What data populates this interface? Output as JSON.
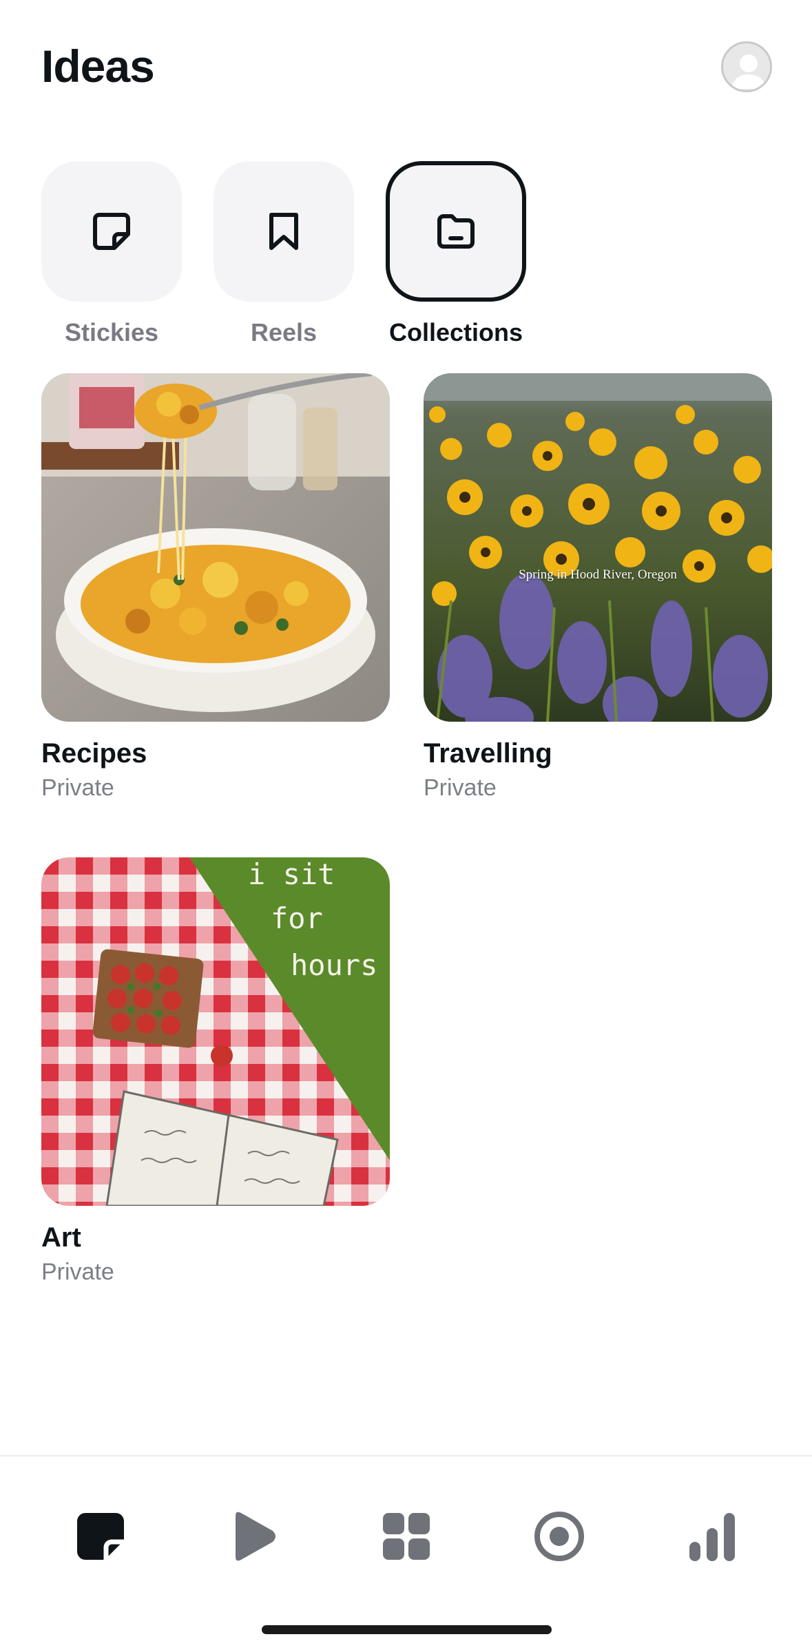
{
  "header": {
    "title": "Ideas"
  },
  "segments": [
    {
      "label": "Stickies",
      "icon": "sticky-note-icon",
      "active": false
    },
    {
      "label": "Reels",
      "icon": "bookmark-icon",
      "active": false
    },
    {
      "label": "Collections",
      "icon": "folder-icon",
      "active": true
    }
  ],
  "collections": [
    {
      "name": "Recipes",
      "privacy": "Private"
    },
    {
      "name": "Travelling",
      "privacy": "Private",
      "image_caption": "Spring in Hood River, Oregon"
    },
    {
      "name": "Art",
      "privacy": "Private",
      "image_text": [
        "i sit",
        "for",
        "hours"
      ]
    }
  ],
  "bottom_nav": [
    {
      "icon": "ideas-tab-icon",
      "active": true
    },
    {
      "icon": "play-icon",
      "active": false
    },
    {
      "icon": "grid-icon",
      "active": false
    },
    {
      "icon": "record-icon",
      "active": false
    },
    {
      "icon": "stats-icon",
      "active": false
    }
  ],
  "colors": {
    "text_primary": "#0f1419",
    "text_secondary": "#7b7f86",
    "tile_bg": "#f4f4f6",
    "nav_inactive": "#6f7278"
  }
}
